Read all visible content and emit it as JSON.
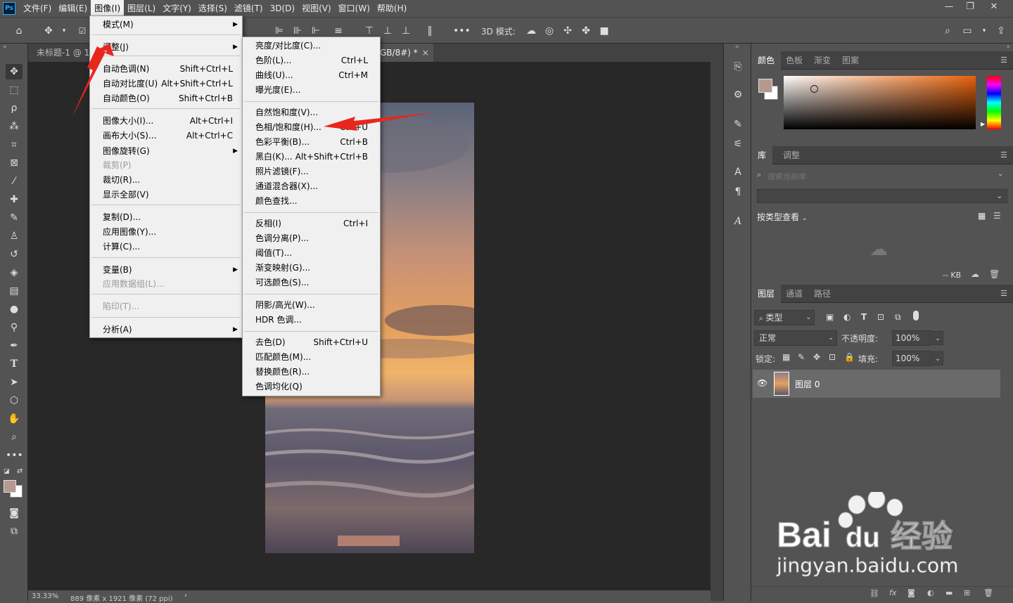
{
  "menubar": {
    "logo": "Ps",
    "items": [
      "文件(F)",
      "编辑(E)",
      "图像(I)",
      "图层(L)",
      "文字(Y)",
      "选择(S)",
      "滤镜(T)",
      "3D(D)",
      "视图(V)",
      "窗口(W)",
      "帮助(H)"
    ],
    "active_index": 2,
    "window_controls": [
      "—",
      "❐",
      "✕"
    ]
  },
  "options_bar": {
    "mode_label": "3D 模式:",
    "more": "•••"
  },
  "doc_tabs": {
    "tab1": "未标题-1 @ 19",
    "tab2": "GB/8#) *",
    "close": "×"
  },
  "image_menu": {
    "items": [
      {
        "label": "模式(M)",
        "shortcut": "",
        "submenu": true,
        "disabled": false
      },
      {
        "label": "调整(J)",
        "shortcut": "",
        "submenu": true,
        "disabled": false
      },
      {
        "label": "自动色调(N)",
        "shortcut": "Shift+Ctrl+L",
        "submenu": false,
        "disabled": false
      },
      {
        "label": "自动对比度(U)",
        "shortcut": "Alt+Shift+Ctrl+L",
        "submenu": false,
        "disabled": false
      },
      {
        "label": "自动颜色(O)",
        "shortcut": "Shift+Ctrl+B",
        "submenu": false,
        "disabled": false
      },
      {
        "label": "图像大小(I)...",
        "shortcut": "Alt+Ctrl+I",
        "submenu": false,
        "disabled": false
      },
      {
        "label": "画布大小(S)...",
        "shortcut": "Alt+Ctrl+C",
        "submenu": false,
        "disabled": false
      },
      {
        "label": "图像旋转(G)",
        "shortcut": "",
        "submenu": true,
        "disabled": false
      },
      {
        "label": "裁剪(P)",
        "shortcut": "",
        "submenu": false,
        "disabled": true
      },
      {
        "label": "裁切(R)...",
        "shortcut": "",
        "submenu": false,
        "disabled": false
      },
      {
        "label": "显示全部(V)",
        "shortcut": "",
        "submenu": false,
        "disabled": false
      },
      {
        "label": "复制(D)...",
        "shortcut": "",
        "submenu": false,
        "disabled": false
      },
      {
        "label": "应用图像(Y)...",
        "shortcut": "",
        "submenu": false,
        "disabled": false
      },
      {
        "label": "计算(C)...",
        "shortcut": "",
        "submenu": false,
        "disabled": false
      },
      {
        "label": "变量(B)",
        "shortcut": "",
        "submenu": true,
        "disabled": false
      },
      {
        "label": "应用数据组(L)...",
        "shortcut": "",
        "submenu": false,
        "disabled": true
      },
      {
        "label": "陷印(T)...",
        "shortcut": "",
        "submenu": false,
        "disabled": true
      },
      {
        "label": "分析(A)",
        "shortcut": "",
        "submenu": true,
        "disabled": false
      }
    ]
  },
  "adjust_menu": {
    "items": [
      {
        "label": "亮度/对比度(C)...",
        "shortcut": ""
      },
      {
        "label": "色阶(L)...",
        "shortcut": "Ctrl+L"
      },
      {
        "label": "曲线(U)...",
        "shortcut": "Ctrl+M"
      },
      {
        "label": "曝光度(E)...",
        "shortcut": ""
      },
      {
        "label": "自然饱和度(V)...",
        "shortcut": ""
      },
      {
        "label": "色相/饱和度(H)...",
        "shortcut": "Ctrl+U"
      },
      {
        "label": "色彩平衡(B)...",
        "shortcut": "Ctrl+B"
      },
      {
        "label": "黑白(K)...",
        "shortcut": "Alt+Shift+Ctrl+B"
      },
      {
        "label": "照片滤镜(F)...",
        "shortcut": ""
      },
      {
        "label": "通道混合器(X)...",
        "shortcut": ""
      },
      {
        "label": "颜色查找...",
        "shortcut": ""
      },
      {
        "label": "反相(I)",
        "shortcut": "Ctrl+I"
      },
      {
        "label": "色调分离(P)...",
        "shortcut": ""
      },
      {
        "label": "阈值(T)...",
        "shortcut": ""
      },
      {
        "label": "渐变映射(G)...",
        "shortcut": ""
      },
      {
        "label": "可选颜色(S)...",
        "shortcut": ""
      },
      {
        "label": "阴影/高光(W)...",
        "shortcut": ""
      },
      {
        "label": "HDR 色调...",
        "shortcut": ""
      },
      {
        "label": "去色(D)",
        "shortcut": "Shift+Ctrl+U"
      },
      {
        "label": "匹配颜色(M)...",
        "shortcut": ""
      },
      {
        "label": "替换颜色(R)...",
        "shortcut": ""
      },
      {
        "label": "色调均化(Q)",
        "shortcut": ""
      }
    ]
  },
  "color_panel": {
    "tabs": [
      "颜色",
      "色板",
      "渐变",
      "图案"
    ],
    "foreground": "#b49a8e"
  },
  "library_panel": {
    "tabs": [
      "库",
      "调整"
    ],
    "search_placeholder": "搜索当前库",
    "view_by": "按类型查看",
    "size": "-- KB"
  },
  "layers_panel": {
    "tabs": [
      "图层",
      "通道",
      "路径"
    ],
    "filter_label": "类型",
    "blend_mode": "正常",
    "opacity_label": "不透明度:",
    "opacity_value": "100%",
    "lock_label": "锁定:",
    "fill_label": "填充:",
    "fill_value": "100%",
    "layer_name": "图层 0"
  },
  "status": {
    "zoom": "33.33%",
    "doc_info": "889 像素 x 1921 像素 (72 ppi)"
  },
  "watermark": {
    "brand": "Bai",
    "brand2": "du",
    "cn": "经验",
    "url": "jingyan.baidu.com"
  },
  "colors": {
    "ui_bg": "#535353",
    "canvas_bg": "#282828",
    "menu_bg": "#f0f0f0",
    "annotation_arrow": "#e8261c",
    "accent_blue": "#31a8ff"
  }
}
